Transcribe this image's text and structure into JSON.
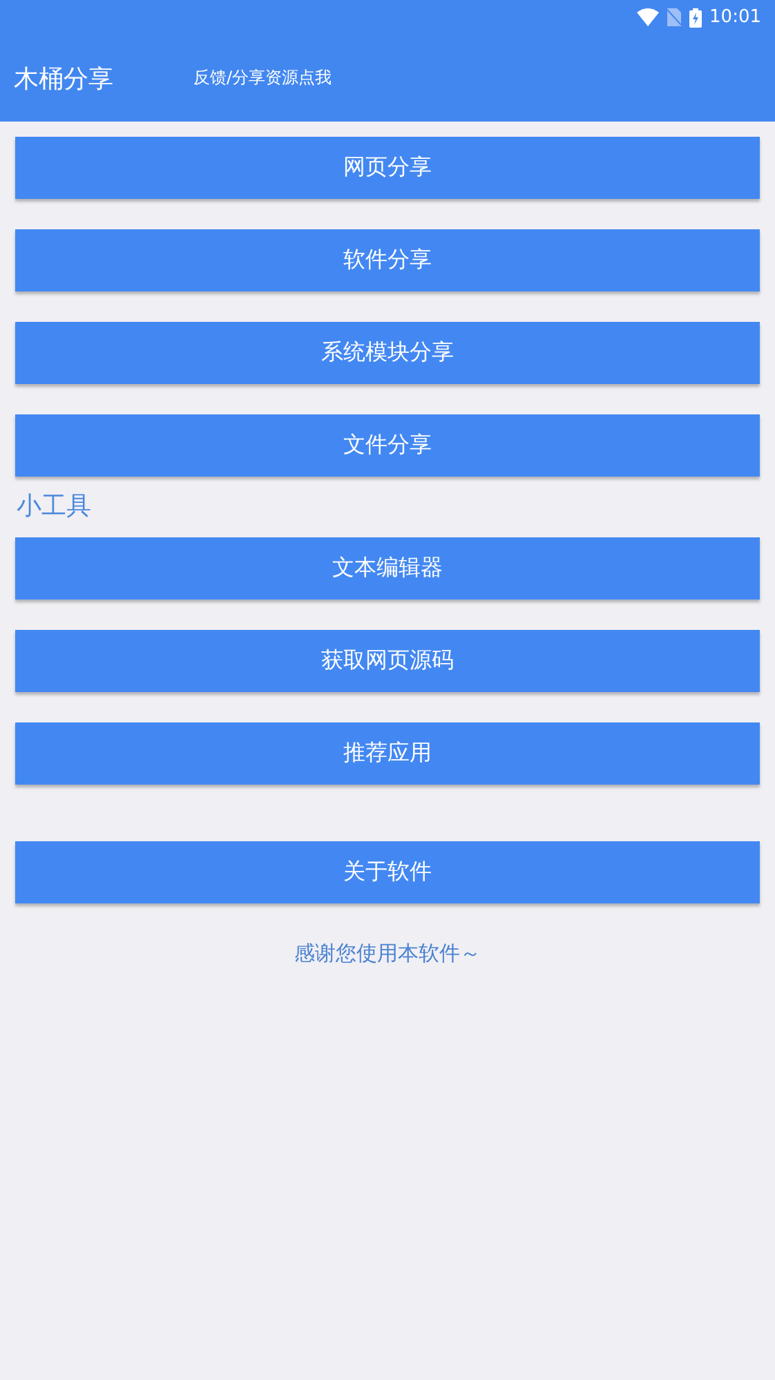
{
  "status_bar": {
    "time": "10:01"
  },
  "app_bar": {
    "title": "木桶分享",
    "link": "反馈/分享资源点我"
  },
  "groups": [
    {
      "buttons": [
        "网页分享",
        "软件分享",
        "系统模块分享",
        "文件分享"
      ]
    },
    {
      "title": "小工具",
      "buttons": [
        "文本编辑器",
        "获取网页源码",
        "推荐应用"
      ]
    },
    {
      "buttons": [
        "关于软件"
      ]
    }
  ],
  "footer": "感谢您使用本软件～"
}
